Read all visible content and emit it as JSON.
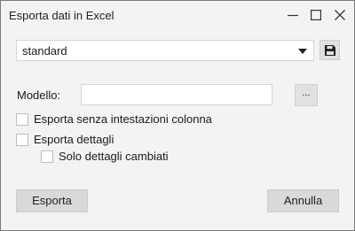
{
  "window": {
    "title": "Esporta dati in Excel",
    "controls": [
      "minimize-icon",
      "maximize-icon",
      "close-icon"
    ]
  },
  "profile_select": {
    "value": "standard",
    "icons": {
      "dropdown": "caret-down-icon",
      "save": "floppy-disk-icon"
    }
  },
  "modello": {
    "label": "Modello:",
    "value": "",
    "browse_label": "..."
  },
  "options": {
    "senza_intestazioni": {
      "label": "Esporta senza intestazioni colonna",
      "checked": false
    },
    "dettagli": {
      "label": "Esporta dettagli",
      "checked": false
    },
    "solo_cambiati": {
      "label": "Solo dettagli cambiati",
      "checked": false
    }
  },
  "buttons": {
    "esporta": "Esporta",
    "annulla": "Annulla"
  }
}
